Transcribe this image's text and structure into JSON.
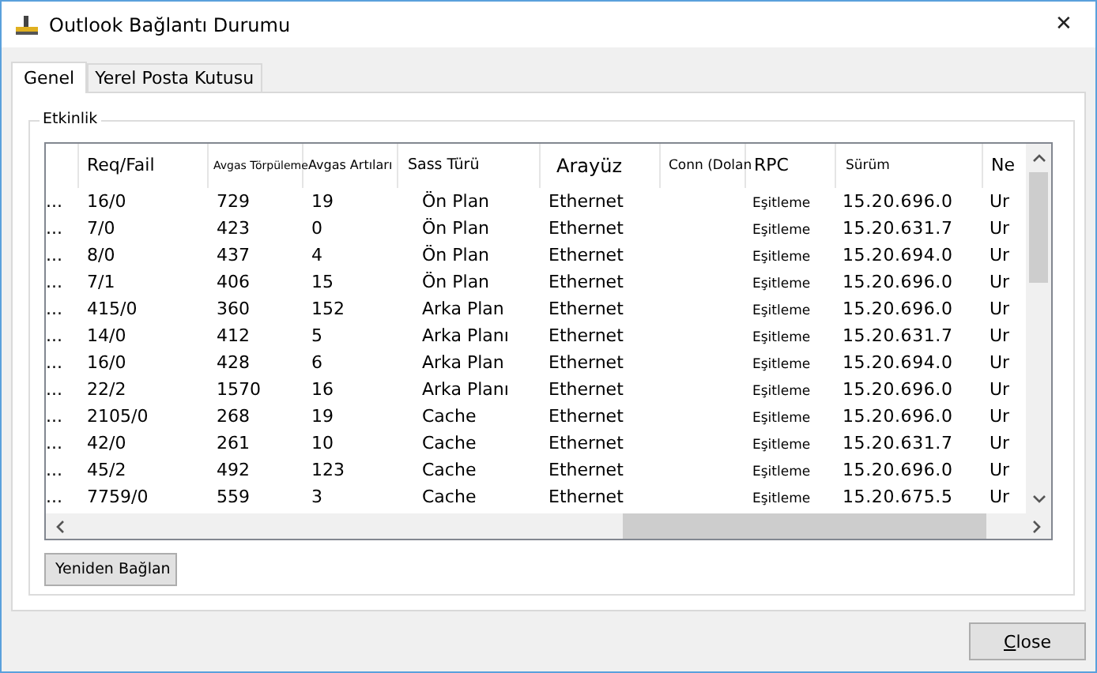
{
  "window": {
    "title": "Outlook Bağlantı Durumu",
    "close": "✕"
  },
  "tabs": [
    {
      "label": "Genel",
      "selected": true
    },
    {
      "label": "Yerel Posta Kutusu",
      "selected": false
    }
  ],
  "group": {
    "title": "Etkinlik"
  },
  "table": {
    "columns": [
      "",
      "Req/Fail",
      "Avgas Törpüleme",
      "Avgas Artıları",
      "Sass Türü",
      "Arayüz",
      "Conn (Dolan",
      "RPC",
      "Sürüm",
      "Ne"
    ],
    "rows": [
      [
        "...",
        "16/0",
        "729",
        "19",
        "Ön Plan",
        "Ethernet",
        "",
        "Eşitleme",
        "15.20.696.0",
        "Ur"
      ],
      [
        "...",
        "7/0",
        "423",
        "0",
        "Ön Plan",
        "Ethernet",
        "",
        "Eşitleme",
        "15.20.631.7",
        "Ur"
      ],
      [
        "...",
        "8/0",
        "437",
        "4",
        "Ön Plan",
        "Ethernet",
        "",
        "Eşitleme",
        "15.20.694.0",
        "Ur"
      ],
      [
        "...",
        "7/1",
        "406",
        "15",
        "Ön Plan",
        "Ethernet",
        "",
        "Eşitleme",
        "15.20.696.0",
        "Ur"
      ],
      [
        "...",
        "415/0",
        "360",
        "152",
        "Arka Plan",
        "Ethernet",
        "",
        "Eşitleme",
        "15.20.696.0",
        "Ur"
      ],
      [
        "...",
        "14/0",
        "412",
        "5",
        "Arka Planı",
        "Ethernet",
        "",
        "Eşitleme",
        "15.20.631.7",
        "Ur"
      ],
      [
        "...",
        "16/0",
        "428",
        "6",
        "Arka Plan",
        "Ethernet",
        "",
        "Eşitleme",
        "15.20.694.0",
        "Ur"
      ],
      [
        "...",
        "22/2",
        "1570",
        "16",
        "Arka Planı",
        "Ethernet",
        "",
        "Eşitleme",
        "15.20.696.0",
        "Ur"
      ],
      [
        "...",
        "2105/0",
        "268",
        "19",
        "Cache",
        "Ethernet",
        "",
        "Eşitleme",
        "15.20.696.0",
        "Ur"
      ],
      [
        "...",
        "42/0",
        "261",
        "10",
        "Cache",
        "Ethernet",
        "",
        "Eşitleme",
        "15.20.631.7",
        "Ur"
      ],
      [
        "...",
        "45/2",
        "492",
        "123",
        "Cache",
        "Ethernet",
        "",
        "Eşitleme",
        "15.20.696.0",
        "Ur"
      ],
      [
        "...",
        "7759/0",
        "559",
        "3",
        "Cache",
        "Ethernet",
        "",
        "Eşitleme",
        "15.20.675.5",
        "Ur"
      ]
    ]
  },
  "buttons": {
    "reconnect": "Yeniden Bağlan",
    "close": "Close"
  }
}
